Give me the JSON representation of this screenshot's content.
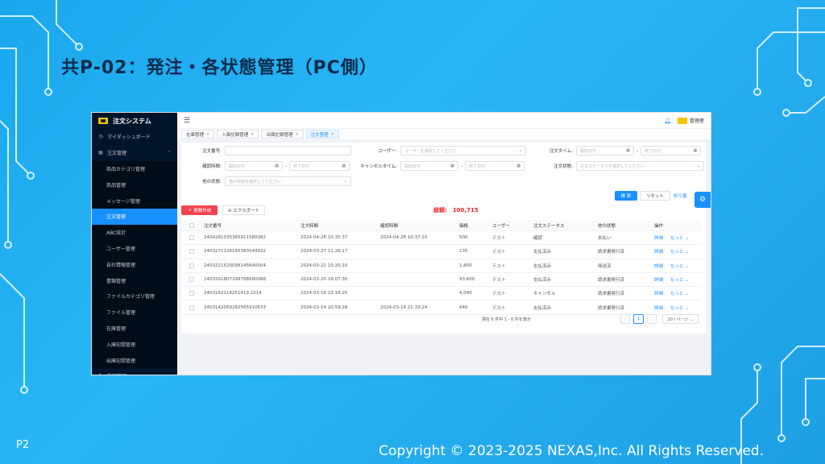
{
  "slide": {
    "title": "共P-02：発注・各状態管理（PC側）",
    "page": "P2",
    "copyright": "Copyright © 2023-2025 NEXAS,Inc. All Rights Reserved."
  },
  "app": {
    "brand": "注文システム",
    "user": "管理者",
    "nav": [
      {
        "label": "マイダッシュボード",
        "icon": "dashboard-icon",
        "glyph": "◷",
        "level": 0
      },
      {
        "label": "注文管理",
        "icon": "document-icon",
        "glyph": "▤",
        "level": 0,
        "expanded": true
      },
      {
        "label": "商品カテゴリ管理",
        "level": 1
      },
      {
        "label": "商品管理",
        "level": 1
      },
      {
        "label": "メッセージ管理",
        "level": 1
      },
      {
        "label": "注文管理",
        "level": 1,
        "active": true
      },
      {
        "label": "ABC統計",
        "level": 1
      },
      {
        "label": "ユーザー管理",
        "level": 1
      },
      {
        "label": "自社情報管理",
        "level": 1
      },
      {
        "label": "書類管理",
        "level": 1
      },
      {
        "label": "ファイルカテゴリ管理",
        "level": 1
      },
      {
        "label": "ファイル管理",
        "level": 1
      },
      {
        "label": "在庫管理",
        "level": 1
      },
      {
        "label": "入庫記録管理",
        "level": 1
      },
      {
        "label": "出庫記録管理",
        "level": 1
      },
      {
        "label": "投稿管理",
        "icon": "edit-icon",
        "glyph": "✎",
        "level": 0
      }
    ],
    "tabs": [
      {
        "label": "在庫管理",
        "active": false
      },
      {
        "label": "入庫記録管理",
        "active": false
      },
      {
        "label": "出庫記録管理",
        "active": false
      },
      {
        "label": "注文管理",
        "active": true
      }
    ],
    "filters": {
      "order_no": {
        "label": "注文番号:",
        "placeholder": ""
      },
      "user": {
        "label": "ユーザー:",
        "placeholder": "ユーザーを選択してください"
      },
      "order_time": {
        "label": "注文タイム:",
        "start": "開始日付",
        "end": "終了日付"
      },
      "confirm_time": {
        "label": "確認時間:",
        "start": "開始日付",
        "end": "終了日付"
      },
      "cancel_time": {
        "label": "キャンセルタイム:",
        "start": "開始日付",
        "end": "終了日付"
      },
      "order_status": {
        "label": "注文状態:",
        "placeholder": "注文ステータスを選択してください"
      },
      "other_status": {
        "label": "他の状態:",
        "placeholder": "他の状態を選択してください"
      }
    },
    "buttons": {
      "search": "検 索",
      "reset": "リセット",
      "collapse": "折り畳",
      "create": "＋ 書類作成",
      "export": "⊖ エクスポート"
    },
    "total": {
      "label": "総額:",
      "value": "100,715"
    },
    "table": {
      "columns": [
        "注文番号",
        "注文時間",
        "確認時間",
        "価格",
        "ユーザー",
        "注文ステータス",
        "他の状態",
        "操作"
      ],
      "rows": [
        {
          "no": "2404281035365911580082",
          "order_time": "2024-04-28 10:35:37",
          "confirm_time": "2024-04-28 10:37:10",
          "price": "500",
          "user": "テスト",
          "status": "確認",
          "other": "未払い",
          "detail": "詳細",
          "more": "もっと ⌄"
        },
        {
          "no": "2403271126165383549932",
          "order_time": "2024-03-27 11:26:17",
          "confirm_time": "",
          "price": "135",
          "user": "テスト",
          "status": "支払済み",
          "other": "請求書発行済",
          "detail": "詳細",
          "more": "もっと ⌄"
        },
        {
          "no": "2403221520098145640004",
          "order_time": "2024-03-22 15:20:10",
          "confirm_time": "",
          "price": "1,800",
          "user": "テスト",
          "status": "支払済み",
          "other": "発送済",
          "detail": "詳細",
          "more": "もっと ⌄"
        },
        {
          "no": "2403201807299788580088",
          "order_time": "2024-03-20 18:07:30",
          "confirm_time": "",
          "price": "93,600",
          "user": "テスト",
          "status": "支払済み",
          "other": "請求書発行済",
          "detail": "詳細",
          "more": "もっと ⌄"
        },
        {
          "no": "2403162218251419 2214",
          "order_time": "2024-03-16 22:18:25",
          "confirm_time": "",
          "price": "4,040",
          "user": "テスト",
          "status": "キャンセル",
          "other": "請求書発行済",
          "detail": "詳細",
          "more": "もっと ⌄"
        },
        {
          "no": "2403142059282565910633",
          "order_time": "2024-03-14 20:59:28",
          "confirm_time": "2024-03-14 21:33:24",
          "price": "640",
          "user": "テスト",
          "status": "支払済み",
          "other": "請求書発行済",
          "detail": "詳細",
          "more": "もっと ⌄"
        }
      ]
    },
    "pagination": {
      "summary": "現在 6 件中 1 - 6 件を表示",
      "prev": "‹",
      "current": "1",
      "next": "›",
      "page_size": "20 / ページ ⌄"
    },
    "icons": {
      "menu": "menu-icon",
      "bell": "bell-icon",
      "settings": "gear-icon",
      "calendar": "calendar-icon",
      "dropdown": "chevron-down-icon"
    },
    "colors": {
      "primary": "#1890ff",
      "sidebar": "#001529",
      "danger": "#f5444f",
      "total": "#f5222d",
      "brand_logo": "#f5c400"
    }
  }
}
